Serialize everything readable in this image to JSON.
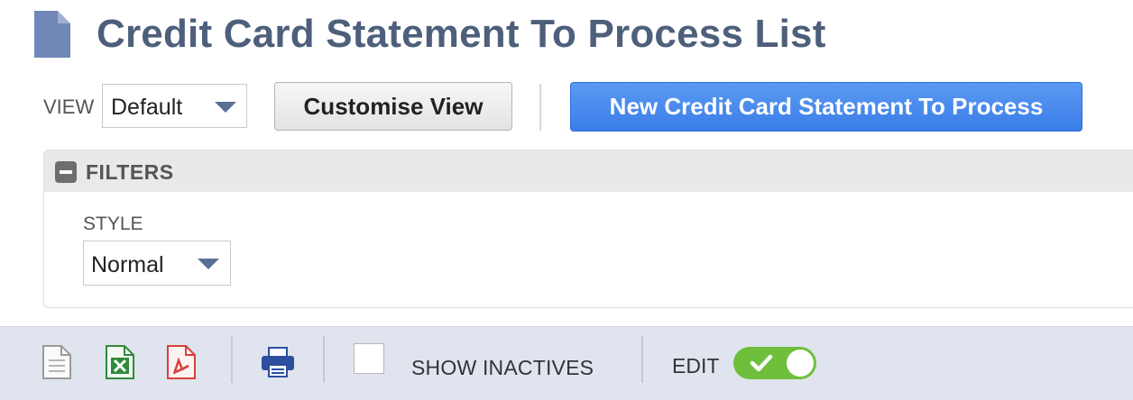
{
  "header": {
    "title": "Credit Card Statement To Process List",
    "icon": "document-icon"
  },
  "view": {
    "label": "VIEW",
    "selected": "Default",
    "customise_label": "Customise View",
    "new_label": "New Credit Card Statement To Process"
  },
  "filters": {
    "title": "FILTERS",
    "style_label": "STYLE",
    "style_selected": "Normal"
  },
  "toolbar": {
    "icons": [
      "export-csv-icon",
      "export-excel-icon",
      "export-pdf-icon",
      "print-icon"
    ],
    "show_inactives_label": "SHOW INACTIVES",
    "show_inactives_checked": false,
    "edit_label": "EDIT",
    "edit_enabled": true
  },
  "colors": {
    "title": "#4d5f7a",
    "primary_button": "#3a7de8",
    "toggle_on": "#6fbf3d",
    "toolbar_bg": "#dfe4ee"
  }
}
